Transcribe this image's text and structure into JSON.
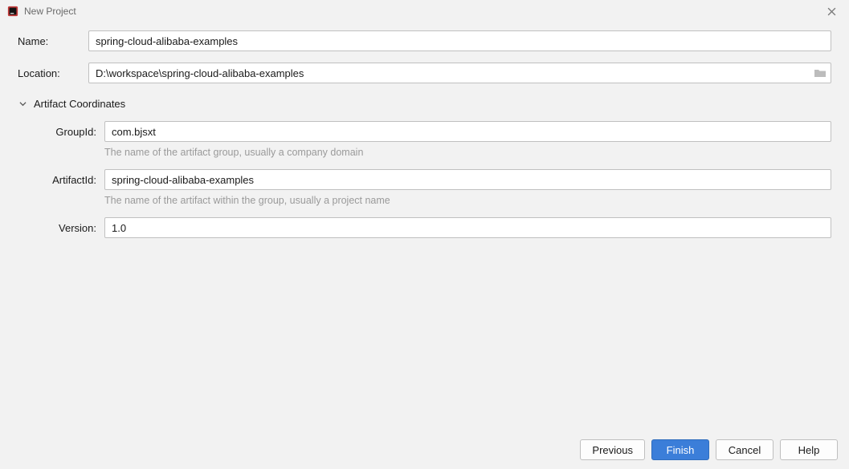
{
  "window": {
    "title": "New Project"
  },
  "form": {
    "name_label": "Name:",
    "name_value": "spring-cloud-alibaba-examples",
    "location_label": "Location:",
    "location_value": "D:\\workspace\\spring-cloud-alibaba-examples"
  },
  "section": {
    "title": "Artifact Coordinates"
  },
  "coords": {
    "groupid_label": "GroupId:",
    "groupid_value": "com.bjsxt",
    "groupid_hint": "The name of the artifact group, usually a company domain",
    "artifactid_label": "ArtifactId:",
    "artifactid_value": "spring-cloud-alibaba-examples",
    "artifactid_hint": "The name of the artifact within the group, usually a project name",
    "version_label": "Version:",
    "version_value": "1.0"
  },
  "buttons": {
    "previous": "Previous",
    "finish": "Finish",
    "cancel": "Cancel",
    "help": "Help"
  }
}
